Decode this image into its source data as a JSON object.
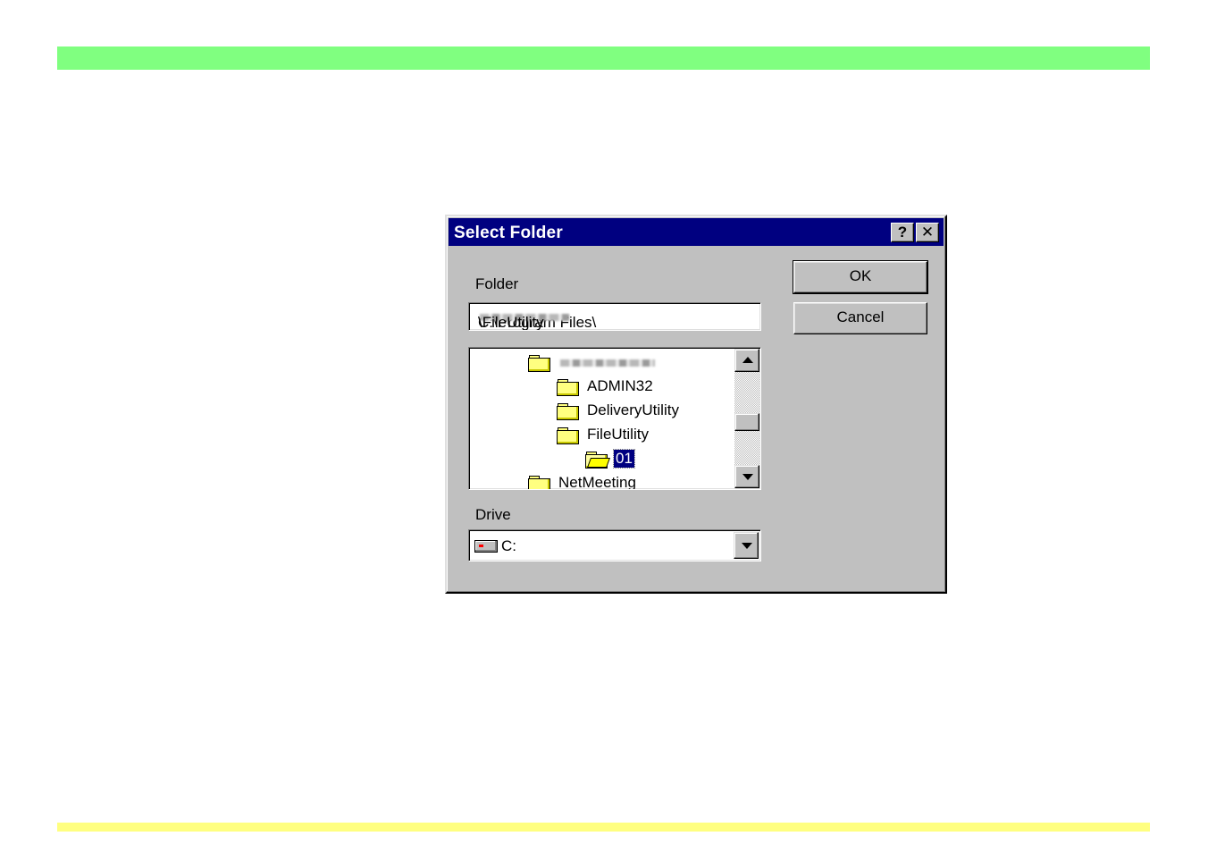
{
  "dialog": {
    "title": "Select Folder",
    "help_label": "?",
    "close_label": "✕",
    "folder_label": "Folder",
    "path_prefix": "C:\\Program Files\\",
    "path_suffix": "\\FileUtility",
    "drive_label": "Drive",
    "drive_value": "C:",
    "ok_label": "OK",
    "cancel_label": "Cancel"
  },
  "tree": {
    "items": [
      {
        "label": "",
        "level": 0,
        "icon": "folder-icon"
      },
      {
        "label": "ADMIN32",
        "level": 1,
        "icon": "folder-icon"
      },
      {
        "label": "DeliveryUtility",
        "level": 1,
        "icon": "folder-icon"
      },
      {
        "label": "FileUtility",
        "level": 1,
        "icon": "folder-icon"
      },
      {
        "label": "01",
        "level": 2,
        "icon": "folder-open-icon",
        "selected": true
      },
      {
        "label": "NetMeeting",
        "level": 0,
        "icon": "folder-icon"
      }
    ]
  },
  "colors": {
    "titlebar": "#000080",
    "dialog_bg": "#c0c0c0",
    "top_bar": "#80ff80",
    "bottom_bar": "#ffff80"
  }
}
